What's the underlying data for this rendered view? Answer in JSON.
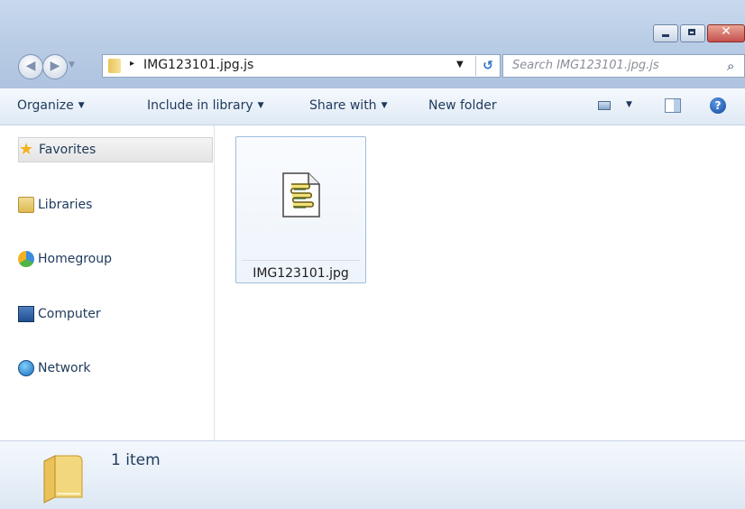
{
  "window": {
    "close_glyph": "✕"
  },
  "address": {
    "separator": "▸",
    "path": "IMG123101.jpg.js",
    "dropdown": "▼",
    "refresh_glyph": "↺"
  },
  "search": {
    "placeholder": "Search IMG123101.jpg.js",
    "icon": "search-icon"
  },
  "toolbar": {
    "organize": "Organize",
    "include": "Include in library",
    "share": "Share with",
    "new_folder": "New folder",
    "caret": "▼",
    "help": "?"
  },
  "sidebar": {
    "items": [
      {
        "label": "Favorites",
        "icon": "star-icon"
      },
      {
        "label": "Libraries",
        "icon": "libraries-icon"
      },
      {
        "label": "Homegroup",
        "icon": "homegroup-icon"
      },
      {
        "label": "Computer",
        "icon": "computer-icon"
      },
      {
        "label": "Network",
        "icon": "network-icon"
      }
    ]
  },
  "files": [
    {
      "name": "IMG123101.jpg",
      "icon": "script-file-icon"
    }
  ],
  "details": {
    "count": "1 item"
  },
  "colors": {
    "accent": "#1e395b",
    "selection_border": "#9fbcdc",
    "toolbar_bg": "#dfe9f5"
  }
}
